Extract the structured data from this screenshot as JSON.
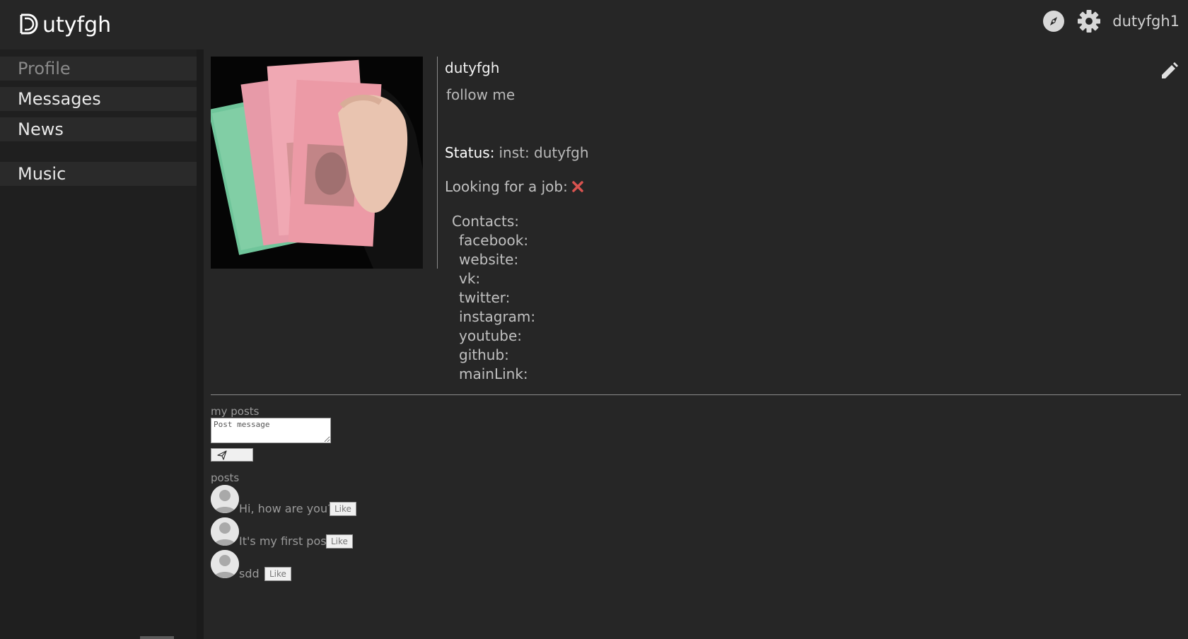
{
  "header": {
    "logo_text": "utyfgh",
    "username": "dutyfgh1",
    "icons": [
      "compass-icon",
      "gear-icon"
    ]
  },
  "sidebar": {
    "items": [
      {
        "label": "Profile",
        "active": true
      },
      {
        "label": "Messages",
        "active": false
      },
      {
        "label": "News",
        "active": false
      },
      {
        "label": "Music",
        "active": false
      }
    ]
  },
  "profile": {
    "name": "dutyfgh",
    "about": "follow me",
    "status_label": "Status:",
    "status_value": "inst: dutyfgh",
    "job_label": "Looking for a job:",
    "job_icon": "cross-icon",
    "job_icon_color": "#d9534f",
    "contacts_title": "Contacts:",
    "contacts": [
      "facebook:",
      "website:",
      "vk:",
      "twitter:",
      "instagram:",
      "youtube:",
      "github:",
      "mainLink:"
    ]
  },
  "posts_section": {
    "my_posts_label": "my posts",
    "input_placeholder": "Post message",
    "posts_label": "posts",
    "like_label": "Like",
    "posts": [
      {
        "text": "Hi, how are you?"
      },
      {
        "text": "It's my first post"
      },
      {
        "text": "sdd"
      }
    ]
  },
  "colors": {
    "background": "#262626",
    "sidebar": "#1f1f1f",
    "nav_item": "#2a2a2a"
  }
}
